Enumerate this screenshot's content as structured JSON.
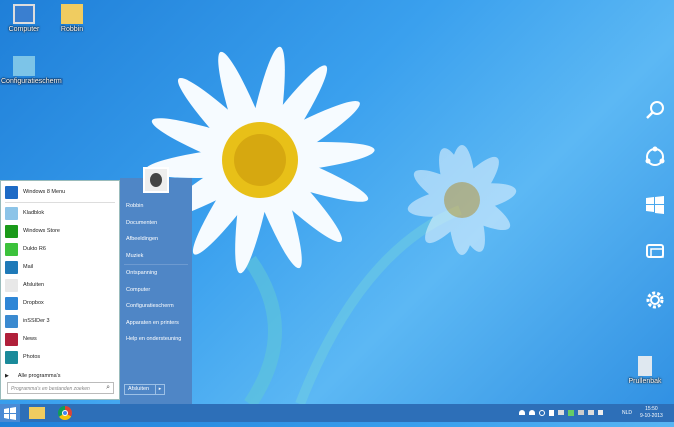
{
  "desktop": {
    "icons": [
      {
        "label": "Computer"
      },
      {
        "label": "Robbin"
      },
      {
        "label": "Configuratiescherm"
      },
      {
        "label": "Prullenbak"
      }
    ]
  },
  "start_menu": {
    "pinned": [
      {
        "label": "Windows 8 Menu",
        "color": "#1e6bc6"
      }
    ],
    "programs": [
      {
        "label": "Kladblok",
        "color": "#8cc4e8"
      },
      {
        "label": "Windows Store",
        "color": "#1a9a1a"
      },
      {
        "label": "Dukto R6",
        "color": "#3cc23c"
      },
      {
        "label": "Mail",
        "color": "#1f7ab8"
      },
      {
        "label": "Afsluiten",
        "color": "#e8e8e8"
      },
      {
        "label": "Dropbox",
        "color": "#2e86d6"
      },
      {
        "label": "inSSIDer 3",
        "color": "#3a8ad0"
      },
      {
        "label": "News",
        "color": "#b0203a"
      },
      {
        "label": "Photos",
        "color": "#1a8a9a"
      }
    ],
    "all_programs": "Alle programma's",
    "search_placeholder": "Programma's en bestanden zoeken",
    "right_items": [
      [
        "Robbin",
        "Documenten",
        "Afbeeldingen",
        "Muziek"
      ],
      [
        "Ontspanning",
        "Computer",
        "Configuratiescherm",
        "Apparaten en printers",
        "Help en ondersteuning"
      ]
    ],
    "shutdown_label": "Afsluiten"
  },
  "taskbar": {
    "language": "NLD",
    "time": "15:50",
    "date": "9-10-2013"
  }
}
